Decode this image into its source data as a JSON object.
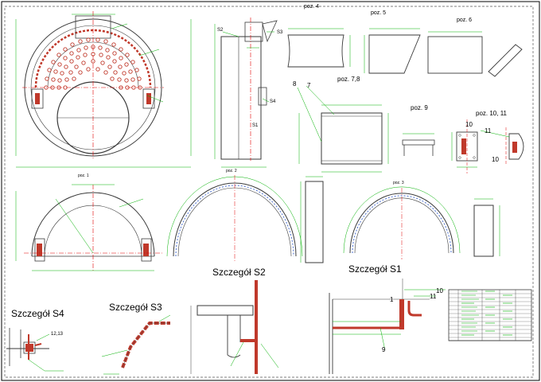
{
  "drawing": {
    "position_labels": {
      "poz4": "poz. 4",
      "poz5": "poz. 5",
      "poz6": "poz. 6",
      "poz78": "poz. 7,8",
      "poz9": "poz. 9",
      "poz1011": "poz. 10, 11",
      "poz1": "poz. 1",
      "poz2": "poz. 2",
      "poz3": "poz. 3"
    },
    "detail_titles": {
      "s1": "Szczegół S1",
      "s2": "Szczegół S2",
      "s3": "Szczegół S3",
      "s4": "Szczegół S4"
    },
    "section_markers": {
      "s1": "S1",
      "s2": "S2",
      "s3": "S3",
      "s4": "S4"
    },
    "callouts": {
      "c7": "7",
      "c8": "8",
      "c9": "9",
      "c10a": "10",
      "c11a": "11",
      "c10b": "10",
      "c11b": "11",
      "c10c": "10",
      "c11c": "11",
      "c1": "1",
      "c1213": "12,13"
    },
    "colors": {
      "outline": "#3a3a3a",
      "dimension": "#00b000",
      "centerline": "#e00000",
      "weld": "#c0392b",
      "frame": "#000000"
    }
  }
}
